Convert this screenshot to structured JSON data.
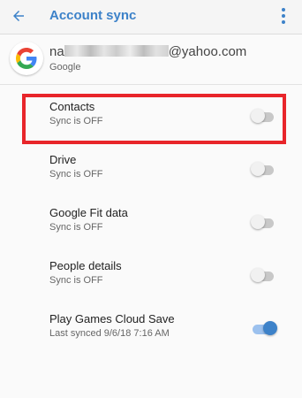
{
  "app_bar": {
    "title": "Account sync"
  },
  "account": {
    "email_visible_prefix": "na",
    "email_visible_suffix": "@yahoo.com",
    "provider": "Google"
  },
  "sync_items": [
    {
      "label": "Contacts",
      "status": "Sync is OFF",
      "enabled": false
    },
    {
      "label": "Drive",
      "status": "Sync is OFF",
      "enabled": false
    },
    {
      "label": "Google Fit data",
      "status": "Sync is OFF",
      "enabled": false
    },
    {
      "label": "People details",
      "status": "Sync is OFF",
      "enabled": false
    },
    {
      "label": "Play Games Cloud Save",
      "status": "Last synced 9/6/18 7:16 AM",
      "enabled": true
    }
  ],
  "colors": {
    "accent": "#3d82c9",
    "highlight_border": "#e8252a",
    "toggle_off_track": "#c8c8c8",
    "toggle_on_track": "#9cc1ee"
  },
  "icons": [
    "back-arrow-icon",
    "more-vert-icon",
    "google-logo-icon"
  ]
}
